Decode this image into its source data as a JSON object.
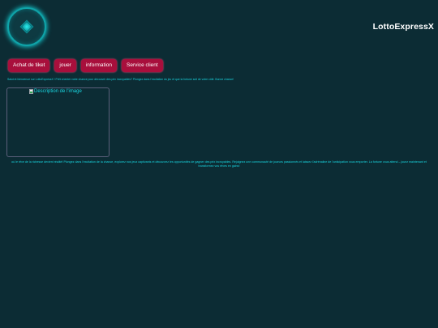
{
  "brand": {
    "name": "LottoExpressX",
    "logo_icon": "lotto-diamond-icon"
  },
  "nav": {
    "items": [
      {
        "label": "Achat de tiket"
      },
      {
        "label": "jouer"
      },
      {
        "label": "information"
      },
      {
        "label": "Service client"
      }
    ]
  },
  "main": {
    "welcome_text": "Salut et bienvenue sur LottoExpressX ! Prêt à tenter votre chance pour découvrir des prix incroyables? Plongez dans l'excitation du jeu et que la fortune soit de votre côté. Bonne chance!",
    "image_alt": "Description de l'image",
    "tagline": "où le rêve de la richesse devient réalité! Plongez dans l'excitation de la chance, explorez nos jeux captivants et découvrez les opportunités de gagner des prix incroyables. Rejoignez une communauté de joueurs passionnés et laissez l'adrénaline de l'anticipation vous emporter. La fortune vous attend – jouez maintenant et transformez vos rêves en gains!"
  },
  "colors": {
    "background": "#0c2c34",
    "button": "#a80f3c",
    "accent_text": "#19d6e0",
    "logo_ring": "#0fa3a8"
  }
}
